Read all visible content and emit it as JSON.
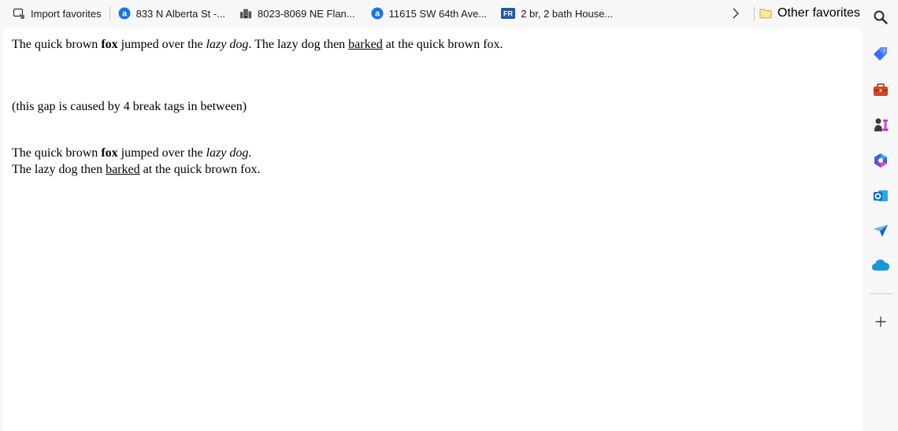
{
  "favorites_bar": {
    "import": {
      "label": "Import favorites",
      "icon": "import-favorites-icon"
    },
    "items": [
      {
        "label": "833 N Alberta St -...",
        "icon": "site-a-icon"
      },
      {
        "label": "8023-8069 NE Flan...",
        "icon": "building-icon"
      },
      {
        "label": "11615 SW 64th Ave...",
        "icon": "site-a-icon"
      },
      {
        "label": "2 br, 2 bath House...",
        "icon": "fr-badge-icon",
        "icon_text": "FR"
      }
    ],
    "other_favorites": {
      "label": "Other favorites",
      "icon": "folder-icon"
    }
  },
  "content": {
    "line1": {
      "a": "The quick brown ",
      "bold": "fox",
      "b": " jumped over the ",
      "italic": "lazy dog",
      "c": ". The lazy dog then ",
      "underline": "barked",
      "d": " at the quick brown fox."
    },
    "gap_note": "(this gap is caused by 4 break tags in between)",
    "line2": {
      "a": "The quick brown ",
      "bold": "fox",
      "b": " jumped over the ",
      "italic": "lazy dog",
      "c": "."
    },
    "line3": {
      "a": "The lazy dog then ",
      "underline": "barked",
      "b": " at the quick brown fox."
    }
  },
  "sidebar": {
    "icons": [
      "search-icon",
      "shopping-tag-icon",
      "tools-icon",
      "games-icon",
      "copilot-icon",
      "outlook-icon",
      "send-icon",
      "cloud-icon",
      "add-icon"
    ]
  },
  "colors": {
    "accent_blue": "#1a73e8",
    "outlook_blue": "#0f6cbd",
    "tag_blue": "#3b6ef5",
    "tools_red": "#d2452d",
    "folder_yellow": "#f2c94c"
  }
}
